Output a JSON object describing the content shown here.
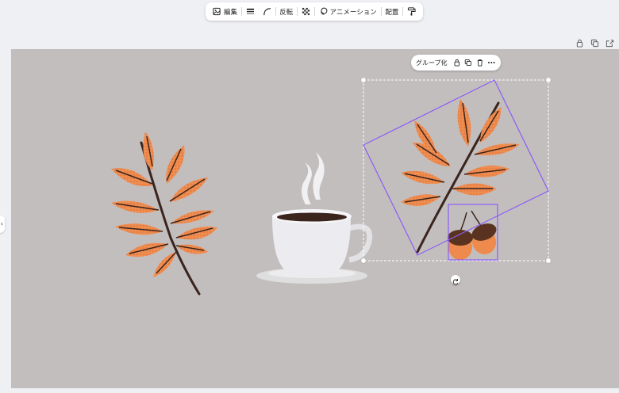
{
  "toolbar": {
    "edit_label": "編集",
    "flip_label": "反転",
    "animation_label": "アニメーション",
    "arrange_label": "配置"
  },
  "group_toolbar": {
    "group_label": "グループ化"
  },
  "colors": {
    "canvas_bg": "#c3bebe",
    "leaf_orange": "#ee8a4d",
    "stem_brown": "#3a241c",
    "selection_purple": "#8b5cf6"
  },
  "icons": [
    "image-edit-icon",
    "lines-icon",
    "corner-icon",
    "transparency-icon",
    "animation-icon",
    "paint-roller-icon",
    "lock-icon",
    "duplicate-icon",
    "trash-icon",
    "more-icon",
    "share-icon",
    "rotate-icon"
  ]
}
